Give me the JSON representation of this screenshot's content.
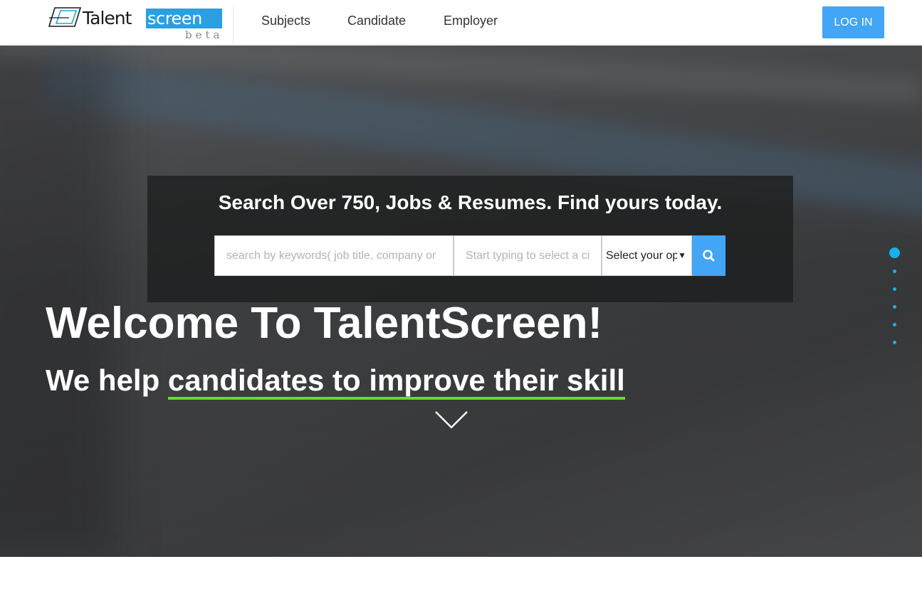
{
  "brand": {
    "name_part1": "Talent",
    "name_part2": "screen",
    "badge": "beta",
    "accent_color": "#2b9fe0"
  },
  "nav": {
    "items": [
      {
        "label": "Subjects"
      },
      {
        "label": "Candidate"
      },
      {
        "label": "Employer"
      }
    ],
    "login_label": "LOG IN",
    "login_color": "#42a5f5"
  },
  "search": {
    "title": "Search Over 750, Jobs & Resumes. Find yours today.",
    "keyword_placeholder": "search by keywords( job title, company or",
    "city_placeholder": "Start typing to select a ci",
    "option_selected": "Select your op",
    "button_icon": "search-icon"
  },
  "hero": {
    "welcome": "Welcome To TalentScreen!",
    "tagline_prefix": "We help ",
    "tagline_highlight": "candidates to improve their skill",
    "highlight_color": "#66dd22",
    "scroll_icon": "chevron-down-icon",
    "slide_dots": {
      "count": 6,
      "active_index": 0,
      "color": "#1ab0f0"
    }
  }
}
